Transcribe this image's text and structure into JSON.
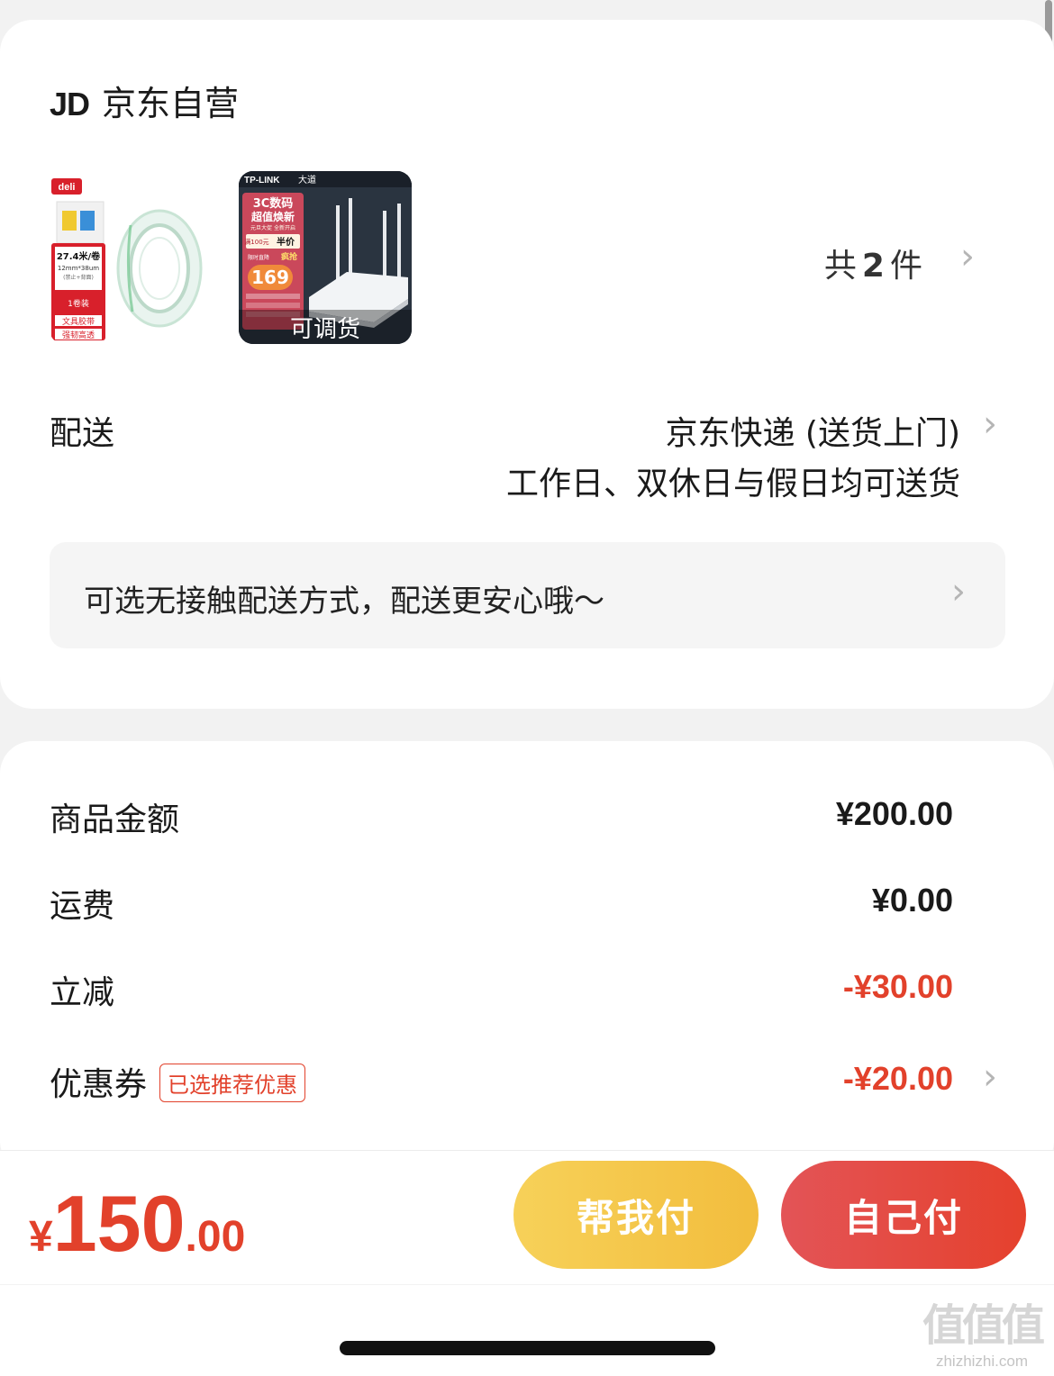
{
  "shop": {
    "logo": "JD",
    "name": "京东自营"
  },
  "products": {
    "thumb1": {
      "brand": "deli",
      "spec": "27.4米/卷",
      "size": "12mm*38um",
      "sub": "(禁止+背面)",
      "pack": "1卷装",
      "type": "文具胶带",
      "feature": "强韧高透"
    },
    "thumb2": {
      "brand": "TP-LINK",
      "brand2": "大道",
      "promo_title": "3C数码",
      "promo_sub": "超值焕新",
      "promo_small": "元旦大促 全新开启",
      "deal1_price": "满100元",
      "deal1": "半价",
      "deal2": "限时直降",
      "deal2_b": "疯抢",
      "price": "169",
      "overlay": "可调货"
    },
    "count_prefix": "共",
    "count": "2",
    "count_suffix": "件"
  },
  "delivery": {
    "label": "配送",
    "method": "京东快递 (送货上门)",
    "schedule": "工作日、双休日与假日均可送货",
    "notice": "可选无接触配送方式，配送更安心哦～"
  },
  "summary": {
    "rows": [
      {
        "label": "商品金额",
        "value": "¥200.00"
      },
      {
        "label": "运费",
        "value": "¥0.00"
      },
      {
        "label": "立减",
        "value": "-¥30.00"
      },
      {
        "label": "优惠券",
        "tag": "已选推荐优惠",
        "value": "-¥20.00"
      }
    ]
  },
  "footer": {
    "total_currency": "¥",
    "total_int": "150",
    "total_dec": ".00",
    "help_pay": "帮我付",
    "self_pay": "自己付"
  },
  "watermark": {
    "glyphs": "值值值",
    "url": "zhizhizhi.com"
  },
  "colors": {
    "accent_red": "#e2412b",
    "help_btn": "#f4c64a",
    "self_btn": "#e4473a"
  }
}
